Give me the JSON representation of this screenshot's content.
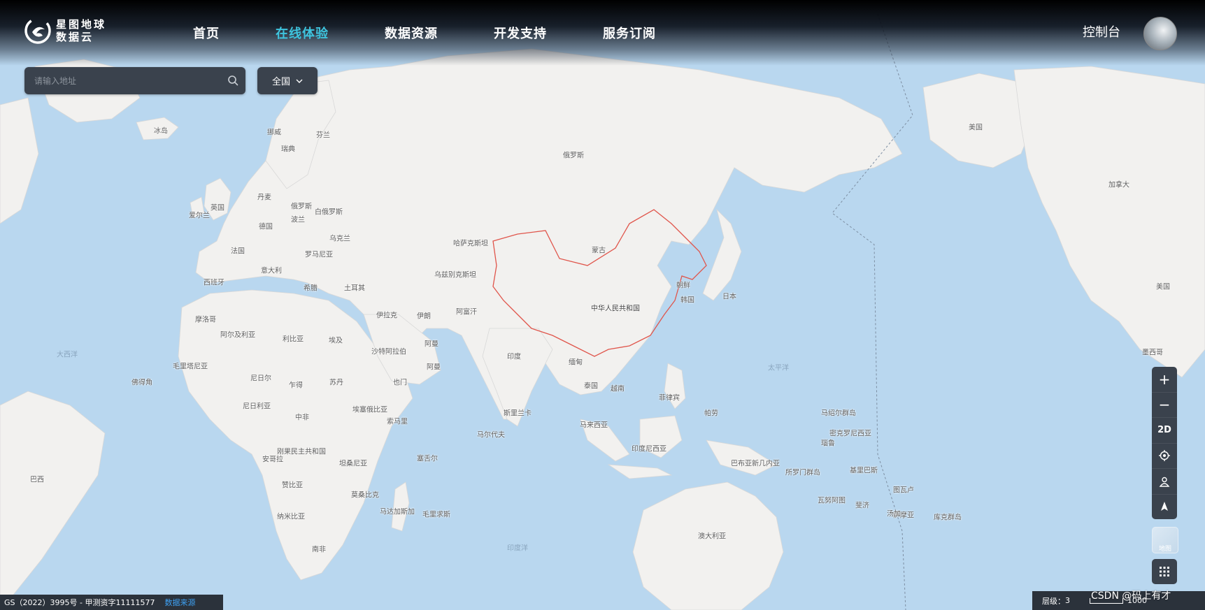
{
  "brand": {
    "line1": "星图地球",
    "line2": "数据云"
  },
  "nav": [
    {
      "label": "首页",
      "active": false
    },
    {
      "label": "在线体验",
      "active": true
    },
    {
      "label": "数据资源",
      "active": false
    },
    {
      "label": "开发支持",
      "active": false
    },
    {
      "label": "服务订阅",
      "active": false
    }
  ],
  "header": {
    "console_label": "控制台"
  },
  "search": {
    "placeholder": "请输入地址",
    "region": "全国"
  },
  "toolbar": {
    "zoom_in": "+",
    "zoom_out": "−",
    "mode": "2D"
  },
  "layer_thumb_label": "地图",
  "footer": {
    "copyright": "GS（2022）3995号 - 甲测资字11111577",
    "data_source": "数据来源",
    "level_label": "层级：",
    "level_value": "3",
    "scale_label": "1000",
    "watermark": "CSDN @码上有才"
  },
  "colors": {
    "ocean": "#b9d7ef",
    "land": "#f2f1ef",
    "accent": "#3ec4de",
    "china_border": "#e0554b",
    "panel": "#3a424d"
  },
  "map_labels": {
    "russia": "俄罗斯",
    "usa_alaska": "美国",
    "canada": "加拿大",
    "usa": "美国",
    "mexico": "墨西哥",
    "iceland": "冰岛",
    "norway": "挪威",
    "finland": "芬兰",
    "sweden": "瑞典",
    "denmark": "丹麦",
    "uk": "英国",
    "ireland": "爱尔兰",
    "germany": "德国",
    "poland": "波兰",
    "russia_eu": "俄罗斯",
    "belarus": "白俄罗斯",
    "ukraine": "乌克兰",
    "france": "法国",
    "romania": "罗马尼亚",
    "italy": "意大利",
    "spain": "西班牙",
    "greece": "希腊",
    "turkey": "土耳其",
    "kazakhstan": "哈萨克斯坦",
    "mongolia": "蒙古",
    "uzbekistan": "乌兹别克斯坦",
    "north_korea": "朝鲜",
    "south_korea": "韩国",
    "japan": "日本",
    "china": "中华人民共和国",
    "iraq": "伊拉克",
    "iran": "伊朗",
    "afghanistan": "阿富汗",
    "morocco": "摩洛哥",
    "algeria": "阿尔及利亚",
    "libya": "利比亚",
    "egypt": "埃及",
    "saudi": "沙特阿拉伯",
    "oman": "阿曼",
    "oman2": "阿曼",
    "yemen": "也门",
    "india": "印度",
    "myanmar": "缅甸",
    "thailand": "泰国",
    "vietnam": "越南",
    "philippines": "菲律宾",
    "atlantic": "大西洋",
    "pacific": "太平洋",
    "indian_ocean": "印度洋",
    "mauritania": "毛里塔尼亚",
    "niger": "尼日尔",
    "chad": "乍得",
    "sudan": "苏丹",
    "nigeria": "尼日利亚",
    "ethiopia": "埃塞俄比亚",
    "somalia": "索马里",
    "cabo_verde": "佛得角",
    "central_africa": "中非",
    "drc": "刚果民主共和国",
    "tanzania": "坦桑尼亚",
    "angola": "安哥拉",
    "zambia": "赞比亚",
    "mozambique": "莫桑比克",
    "namibia": "纳米比亚",
    "south_africa": "南非",
    "madagascar": "马达加斯加",
    "mauritius": "毛里求斯",
    "seychelles": "塞舌尔",
    "maldives": "马尔代夫",
    "sri_lanka": "斯里兰卡",
    "malaysia": "马来西亚",
    "indonesia": "印度尼西亚",
    "png": "巴布亚新几内亚",
    "palau": "帕劳",
    "marshall": "马绍尔群岛",
    "micronesia": "密克罗尼西亚",
    "nauru": "瑙鲁",
    "solomon": "所罗门群岛",
    "kiribati": "基里巴斯",
    "tuvalu": "图瓦卢",
    "vanuatu": "瓦努阿图",
    "samoa": "萨摩亚",
    "fiji": "斐济",
    "tonga": "汤加",
    "cook": "库克群岛",
    "australia": "澳大利亚",
    "brazil": "巴西"
  }
}
